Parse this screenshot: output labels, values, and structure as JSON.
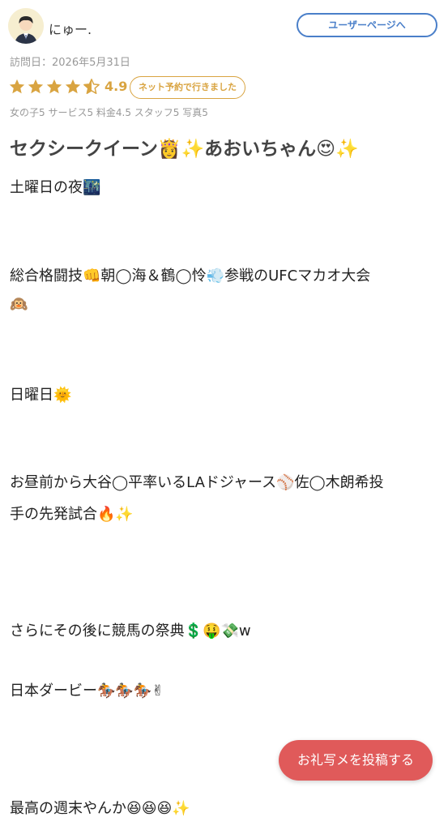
{
  "header": {
    "username": "にゅー.",
    "user_page_label": "ユーザーページへ"
  },
  "review": {
    "visit_date": "訪問日：2026年5月31日",
    "rating": "4.9",
    "rating_value": 4.9,
    "rating_max": 5,
    "reservation_badge": "ネット予約で行きました",
    "sub_scores": "女の子5 サービス5 料金4.5 スタッフ5 写真5",
    "title": "セクシークイーン👸✨あおいちゃん😍✨",
    "lines": [
      "土曜日の夜🌃",
      "総合格闘技👊朝◯海＆鶴◯怜💨参戦のUFCマカオ大会",
      "🙉",
      "日曜日🌞",
      "お昼前から大谷◯平率いるLAドジャース⚾佐◯木朗希投",
      "手の先発試合🔥✨",
      "さらにその後に競馬の祭典💲🤑💸w",
      "日本ダービー🏇🏇🏇✌",
      "最高の週末やんか😆😆😆✨"
    ]
  },
  "actions": {
    "photo_post_label": "お礼写メを投稿する"
  },
  "colors": {
    "accent_blue": "#4a7fc9",
    "star_gold": "#d9a441",
    "cta_red": "#e05a5a"
  }
}
